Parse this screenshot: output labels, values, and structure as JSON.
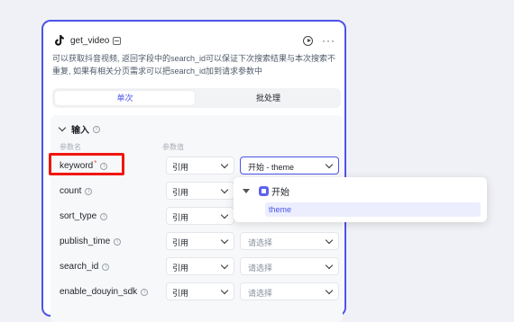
{
  "node": {
    "title": "get_video",
    "description": "可以获取抖音视频, 返回字段中的search_id可以保证下次搜索结果与本次搜索不重复, 如果有相关分页需求可以把search_id加到请求参数中",
    "tabs": [
      "单次",
      "批处理"
    ],
    "active_tab": "单次"
  },
  "input_section": {
    "title": "输入",
    "col_param_name": "参数名",
    "col_param_value": "参数值",
    "rows": [
      {
        "name": "keyword",
        "required": true,
        "mode": "引用",
        "value": "开始 - theme",
        "placeholder": false
      },
      {
        "name": "count",
        "required": false,
        "mode": "引用",
        "value": "请选择",
        "placeholder": true
      },
      {
        "name": "sort_type",
        "required": false,
        "mode": "引用",
        "value": "请选择",
        "placeholder": true
      },
      {
        "name": "publish_time",
        "required": false,
        "mode": "引用",
        "value": "请选择",
        "placeholder": true
      },
      {
        "name": "search_id",
        "required": false,
        "mode": "引用",
        "value": "请选择",
        "placeholder": true
      },
      {
        "name": "enable_douyin_sdk",
        "required": false,
        "mode": "引用",
        "value": "请选择",
        "placeholder": true
      }
    ]
  },
  "dropdown": {
    "group_label": "开始",
    "item": "theme"
  },
  "colors": {
    "accent": "#4d53e8",
    "highlight_box": "#f0160e"
  },
  "icons": [
    "tiktok-icon",
    "doc-icon",
    "play-icon",
    "more-icon",
    "info-icon",
    "chevron-down-icon",
    "start-node-icon"
  ]
}
